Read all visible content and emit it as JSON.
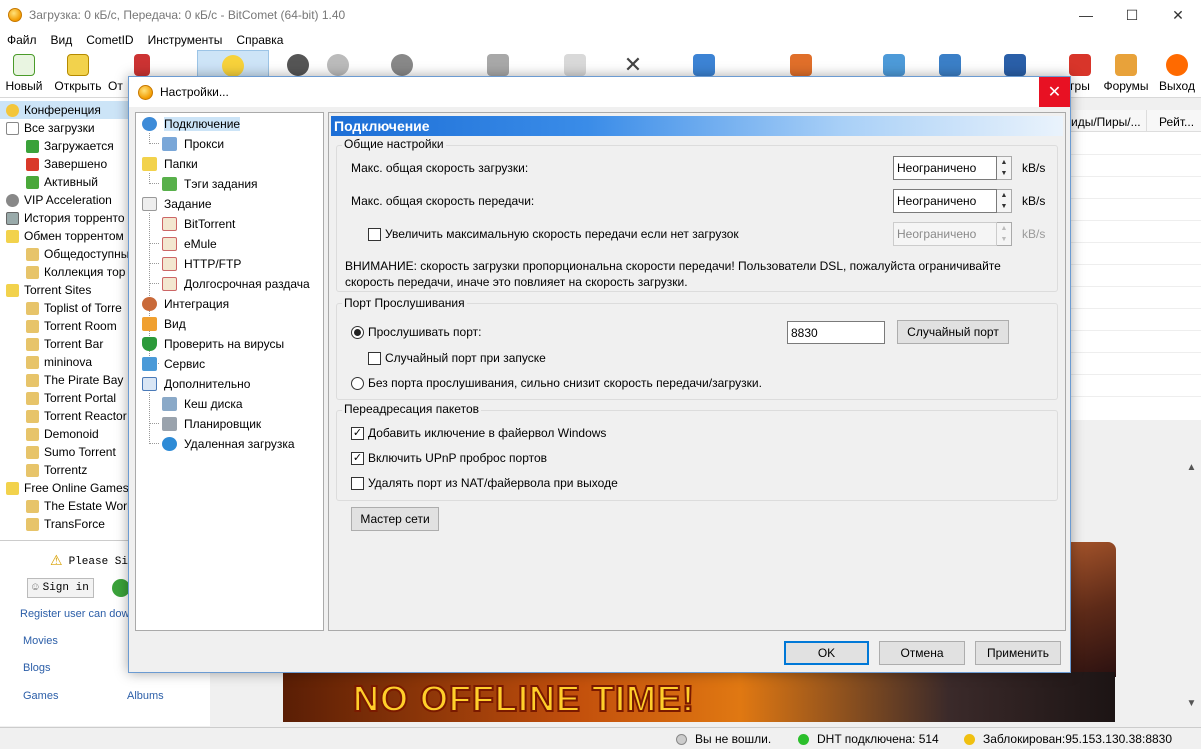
{
  "window": {
    "title": "Загрузка: 0 кБ/с, Передача: 0 кБ/с - BitComet (64-bit) 1.40"
  },
  "menu": [
    "Файл",
    "Вид",
    "CometID",
    "Инструменты",
    "Справка"
  ],
  "toolbar": {
    "new": "Новый",
    "open": "Открыть",
    "open_cut": "От",
    "right_cut": "гры",
    "forums": "Форумы",
    "exit": "Выход"
  },
  "sidebar": {
    "items": [
      {
        "label": "Конференция",
        "level": 0
      },
      {
        "label": "Все загрузки",
        "level": 0
      },
      {
        "label": "Загружается",
        "level": 1
      },
      {
        "label": "Завершено",
        "level": 1
      },
      {
        "label": "Активный",
        "level": 1
      },
      {
        "label": "VIP Acceleration",
        "level": 0
      },
      {
        "label": "История торренто",
        "level": 0
      },
      {
        "label": "Обмен торрентом",
        "level": 0
      },
      {
        "label": "Общедоступны",
        "level": 1
      },
      {
        "label": "Коллекция тор",
        "level": 1
      },
      {
        "label": "Torrent Sites",
        "level": 0
      },
      {
        "label": "Toplist of Torre",
        "level": 1
      },
      {
        "label": "Torrent Room",
        "level": 1
      },
      {
        "label": "Torrent Bar",
        "level": 1
      },
      {
        "label": "mininova",
        "level": 1
      },
      {
        "label": "The Pirate Bay",
        "level": 1
      },
      {
        "label": "Torrent Portal",
        "level": 1
      },
      {
        "label": "Torrent Reactor",
        "level": 1
      },
      {
        "label": "Demonoid",
        "level": 1
      },
      {
        "label": "Sumo Torrent",
        "level": 1
      },
      {
        "label": "Torrentz",
        "level": 1
      },
      {
        "label": "Free Online Games",
        "level": 0
      },
      {
        "label": "The Estate Worl",
        "level": 1
      },
      {
        "label": "TransForce",
        "level": 1
      }
    ]
  },
  "lower_left": {
    "please_sign": "Please Si",
    "sign_in": "Sign in",
    "register": "Register user can dow",
    "links": [
      "Movies",
      "Blogs",
      "Games",
      "Albums"
    ]
  },
  "right_pane": {
    "col1": "иды/Пиры/...",
    "col2": "Рейт..."
  },
  "banner": {
    "text": "NO OFFLINE TIME!"
  },
  "status": {
    "login": "Вы не вошли.",
    "dht": "DHT подключена: 514",
    "blocked": "Заблокирован:95.153.130.38:8830"
  },
  "dialog": {
    "title": "Настройки...",
    "close": "✕",
    "tree": [
      {
        "label": "Подключение",
        "level": 0,
        "selected": true
      },
      {
        "label": "Прокси",
        "level": 1
      },
      {
        "label": "Папки",
        "level": 0
      },
      {
        "label": "Тэги задания",
        "level": 1
      },
      {
        "label": "Задание",
        "level": 0
      },
      {
        "label": "BitTorrent",
        "level": 1
      },
      {
        "label": "eMule",
        "level": 1
      },
      {
        "label": "HTTP/FTP",
        "level": 1
      },
      {
        "label": "Долгосрочная раздача",
        "level": 1
      },
      {
        "label": "Интеграция",
        "level": 0
      },
      {
        "label": "Вид",
        "level": 0
      },
      {
        "label": "Проверить на вирусы",
        "level": 0
      },
      {
        "label": "Сервис",
        "level": 0
      },
      {
        "label": "Дополнительно",
        "level": 0
      },
      {
        "label": "Кеш диска",
        "level": 1
      },
      {
        "label": "Планировщик",
        "level": 1
      },
      {
        "label": "Удаленная загрузка",
        "level": 1
      }
    ],
    "panel": {
      "heading": "Подключение",
      "general": {
        "label": "Общие настройки",
        "max_down_label": "Макс. общая скорость загрузки:",
        "max_down_value": "Неограничено",
        "max_up_label": "Макс. общая скорость передачи:",
        "max_up_value": "Неограничено",
        "unit": "kB/s",
        "boost_label": "Увеличить максимальную скорость передачи если нет загрузок",
        "boost_checked": false,
        "boost_value": "Неограничено",
        "warning_line1": "ВНИМАНИЕ: скорость загрузки пропорциональна скорости передачи! Пользователи DSL, пожалуйста ограничивайте",
        "warning_line2": "скорость передачи, иначе это повлияет на скорость загрузки."
      },
      "port": {
        "label": "Порт Прослушивания",
        "listen_label": "Прослушивать порт:",
        "listen_selected": true,
        "port_value": "8830",
        "random_button": "Случайный порт",
        "random_on_start": "Случайный порт при запуске",
        "random_on_start_checked": false,
        "no_listen_label": "Без порта прослушивания, сильно снизит скорость передачи/загрузки."
      },
      "forwarding": {
        "label": "Переадресация пакетов",
        "firewall": "Добавить иключение в файервол Windows",
        "firewall_checked": true,
        "upnp": "Включить UPnP проброс портов",
        "upnp_checked": true,
        "remove_nat": "Удалять порт из NAT/файервола при выходе",
        "remove_nat_checked": false
      },
      "wizard_button": "Мастер сети"
    },
    "buttons": {
      "ok": "OK",
      "cancel": "Отмена",
      "apply": "Применить"
    }
  }
}
